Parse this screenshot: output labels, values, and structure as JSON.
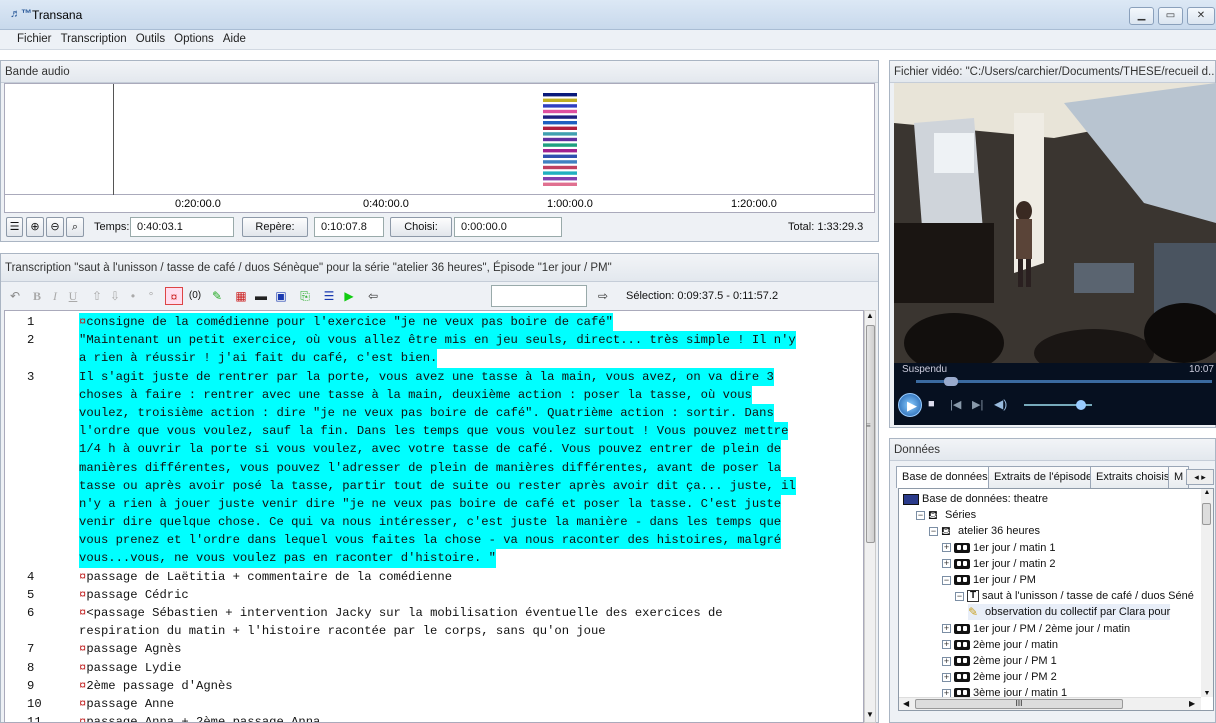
{
  "window": {
    "title": "Transana",
    "logo": "♬™"
  },
  "menu": [
    "Fichier",
    "Transcription",
    "Outils",
    "Options",
    "Aide"
  ],
  "audio": {
    "title": "Bande audio",
    "ticks": [
      "0:20:00.0",
      "0:40:00.0",
      "1:00:00.0",
      "1:20:00.0"
    ],
    "time_label": "Temps:",
    "time_value": "0:40:03.1",
    "repere_label": "Repère:",
    "repere_value": "0:10:07.8",
    "choisi_label": "Choisi:",
    "choisi_value": "0:00:00.0",
    "total": "Total:  1:33:29.3",
    "bar_colors": [
      "#0a1a7a",
      "#c0b020",
      "#3040c0",
      "#e050a0",
      "#202080",
      "#2060c0",
      "#b02040",
      "#40a0b0",
      "#6030a0",
      "#20a080",
      "#a02090",
      "#3050b0",
      "#4080c0",
      "#c04060",
      "#20b0c0",
      "#8040b0",
      "#e07090"
    ]
  },
  "transcript": {
    "title": "Transcription \"saut à l'unisson / tasse de café / duos Sénèque\" pour la série \"atelier 36 heures\", Épisode \"1er jour / PM\"",
    "selection": "Sélection: 0:09:37.5 - 0:11:57.2",
    "search_value": "",
    "lines": [
      {
        "n": "1",
        "t": "consigne de la comédienne pour l'exercice \"je ne veux pas boire de café\"",
        "hl": true,
        "mark": true
      },
      {
        "n": "2",
        "t": "\"Maintenant un petit exercice, où vous allez être mis en jeu seuls, direct... très simple ! Il n'y",
        "hl": true,
        "mark": false
      },
      {
        "n": "",
        "t": "a rien à réussir ! j'ai fait du café, c'est bien.",
        "hl": true,
        "mark": false
      },
      {
        "n": "3",
        "t": "Il s'agit juste de rentrer par la porte, vous avez une tasse à la main, vous avez, on va dire 3",
        "hl": true,
        "mark": false
      },
      {
        "n": "",
        "t": "choses à faire : rentrer avec une tasse à la main, deuxième action : poser la tasse, où vous",
        "hl": true,
        "mark": false
      },
      {
        "n": "",
        "t": "voulez, troisième action : dire \"je ne veux pas boire de café\". Quatrième action : sortir. Dans",
        "hl": true,
        "mark": false
      },
      {
        "n": "",
        "t": "l'ordre que vous voulez, sauf la fin. Dans les temps que vous voulez surtout ! Vous pouvez mettre",
        "hl": true,
        "mark": false
      },
      {
        "n": "",
        "t": "1/4 h à ouvrir la porte si vous voulez, avec votre tasse de café. Vous pouvez entrer de plein de",
        "hl": true,
        "mark": false
      },
      {
        "n": "",
        "t": "manières différentes, vous pouvez l'adresser de plein de manières différentes, avant de poser la",
        "hl": true,
        "mark": false
      },
      {
        "n": "",
        "t": "tasse ou après avoir posé la tasse, partir tout de suite ou rester après avoir dit ça... juste, il",
        "hl": true,
        "mark": false
      },
      {
        "n": "",
        "t": "n'y a rien à jouer juste venir dire \"je ne veux pas boire de café et poser la tasse. C'est juste",
        "hl": true,
        "mark": false
      },
      {
        "n": "",
        "t": "venir dire quelque chose. Ce qui va nous intéresser, c'est juste la manière - dans les temps que",
        "hl": true,
        "mark": false
      },
      {
        "n": "",
        "t": "vous prenez et l'ordre dans lequel vous faites la chose - va nous raconter des histoires, malgré",
        "hl": true,
        "mark": false
      },
      {
        "n": "",
        "t": "vous...vous, ne vous voulez pas en raconter d'histoire. \"",
        "hl": true,
        "mark": false
      },
      {
        "n": "4",
        "t": "passage de Laëtitia + commentaire de la comédienne",
        "hl": false,
        "mark": true
      },
      {
        "n": "5",
        "t": "passage Cédric",
        "hl": false,
        "mark": true
      },
      {
        "n": "6",
        "t": "<passage Sébastien + intervention Jacky sur la mobilisation éventuelle des exercices de",
        "hl": false,
        "mark": true
      },
      {
        "n": "",
        "t": "respiration du matin + l'histoire racontée par le corps, sans qu'on joue",
        "hl": false,
        "mark": false
      },
      {
        "n": "7",
        "t": "passage Agnès",
        "hl": false,
        "mark": true
      },
      {
        "n": "8",
        "t": "passage Lydie",
        "hl": false,
        "mark": true
      },
      {
        "n": "9",
        "t": "2ème passage d'Agnès",
        "hl": false,
        "mark": true
      },
      {
        "n": "10",
        "t": "passage Anne",
        "hl": false,
        "mark": true
      },
      {
        "n": "11",
        "t": "passage Anna + 2ème passage Anna",
        "hl": false,
        "mark": true
      }
    ]
  },
  "video": {
    "title": "Fichier vidéo: \"C:/Users/carchier/Documents/THESE/recueil d...",
    "status": "Suspendu",
    "time": "10:07"
  },
  "data": {
    "title": "Données",
    "tabs": [
      "Base de données",
      "Extraits de l'épisode",
      "Extraits choisis",
      "M"
    ],
    "tree": [
      {
        "label": "Base de données: theatre",
        "level": 0,
        "icon": "database",
        "exp": ""
      },
      {
        "label": "Séries",
        "level": 1,
        "icon": "camera",
        "exp": "-"
      },
      {
        "label": "atelier 36 heures",
        "level": 2,
        "icon": "camera",
        "exp": "-"
      },
      {
        "label": "1er jour / matin 1",
        "level": 3,
        "icon": "tape",
        "exp": "+"
      },
      {
        "label": "1er jour / matin 2",
        "level": 3,
        "icon": "tape",
        "exp": "+"
      },
      {
        "label": "1er jour / PM",
        "level": 3,
        "icon": "tape",
        "exp": "-"
      },
      {
        "label": "saut à l'unisson / tasse de café / duos Séné",
        "level": 4,
        "icon": "transcript",
        "exp": "-"
      },
      {
        "label": "observation du collectif par Clara pour",
        "level": 5,
        "icon": "note",
        "exp": ""
      },
      {
        "label": "1er jour / PM / 2ème jour / matin",
        "level": 3,
        "icon": "tape",
        "exp": "+"
      },
      {
        "label": "2ème jour / matin",
        "level": 3,
        "icon": "tape",
        "exp": "+"
      },
      {
        "label": "2ème jour / PM 1",
        "level": 3,
        "icon": "tape",
        "exp": "+"
      },
      {
        "label": "2ème jour / PM 2",
        "level": 3,
        "icon": "tape",
        "exp": "+"
      },
      {
        "label": "3ème jour / matin 1",
        "level": 3,
        "icon": "tape",
        "exp": "+"
      }
    ],
    "hscroll_label": "III"
  }
}
